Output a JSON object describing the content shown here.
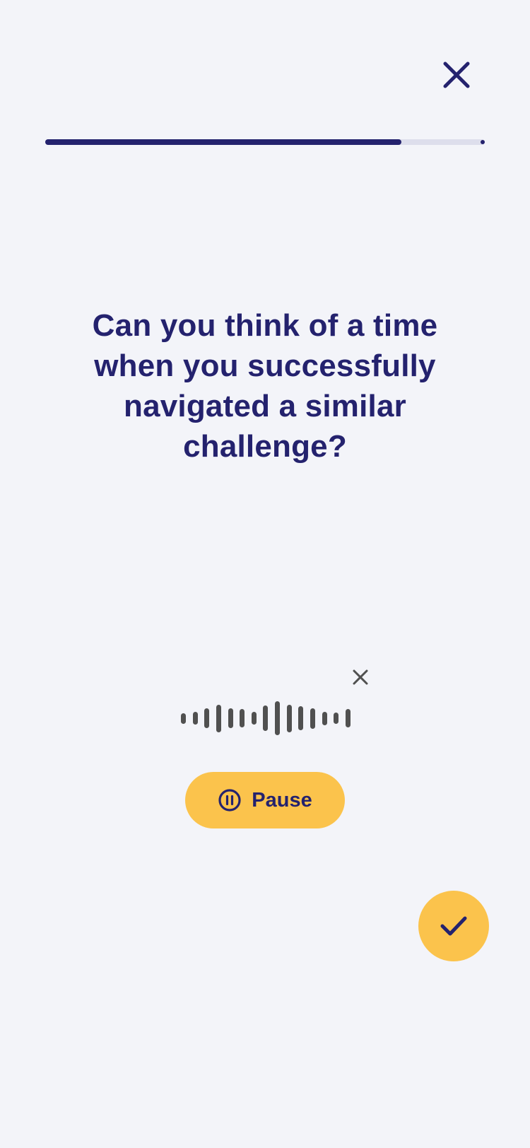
{
  "header": {
    "close_icon": "close-icon"
  },
  "progress": {
    "fraction": 0.81
  },
  "question": {
    "text": "Can you think of a time when you successfully navigated a similar challenge?"
  },
  "recording": {
    "discard_icon": "close-icon",
    "waveform_levels": [
      0.3,
      0.35,
      0.55,
      0.78,
      0.55,
      0.52,
      0.35,
      0.72,
      0.95,
      0.78,
      0.68,
      0.58,
      0.38,
      0.32,
      0.52
    ]
  },
  "pause_button": {
    "label": "Pause",
    "icon": "pause-circle-icon"
  },
  "confirm_button": {
    "icon": "checkmark-icon"
  },
  "colors": {
    "background": "#F3F4F9",
    "primary": "#24226E",
    "accent": "#FBC34C",
    "waveform": "#505050",
    "track": "#DDDEEC"
  }
}
